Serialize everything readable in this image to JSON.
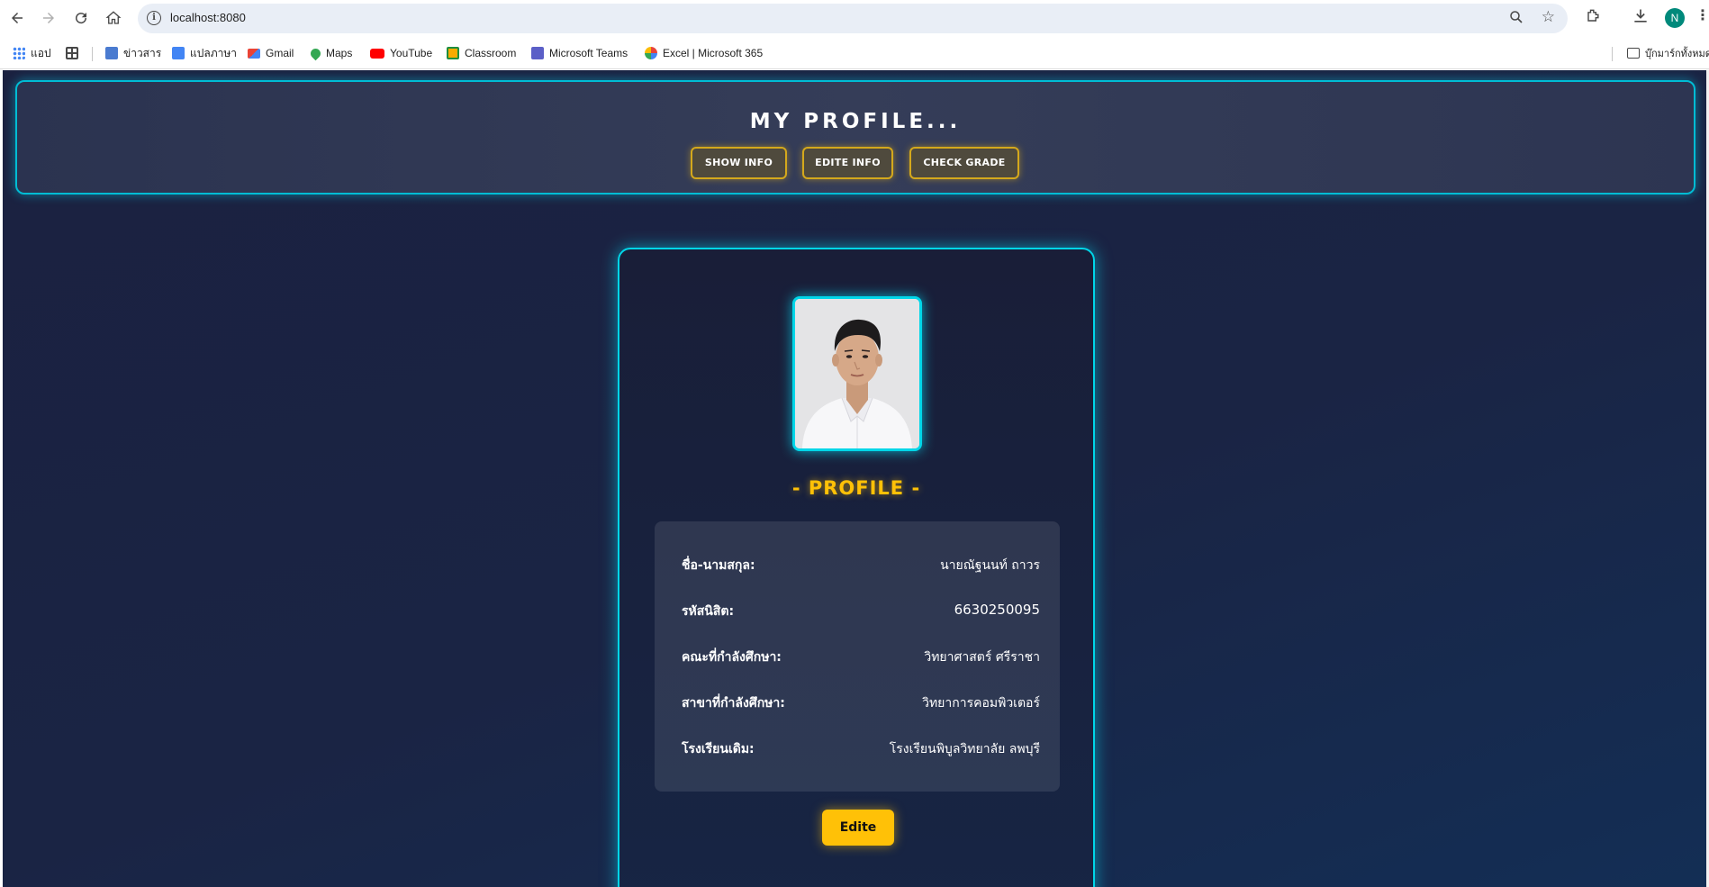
{
  "browser": {
    "url": "localhost:8080",
    "profile_initial": "N",
    "bookmarks": [
      {
        "label": "แอป",
        "icon": "apps-grid-icon"
      },
      {
        "label": "",
        "icon": "tab-groups-icon"
      },
      {
        "label": "ข่าวสาร",
        "icon": "news-icon"
      },
      {
        "label": "แปลภาษา",
        "icon": "translate-icon"
      },
      {
        "label": "Gmail",
        "icon": "gmail-icon"
      },
      {
        "label": "Maps",
        "icon": "maps-icon"
      },
      {
        "label": "YouTube",
        "icon": "youtube-icon"
      },
      {
        "label": "Classroom",
        "icon": "classroom-icon"
      },
      {
        "label": "Microsoft Teams",
        "icon": "teams-icon"
      },
      {
        "label": "Excel | Microsoft 365",
        "icon": "excel-icon"
      }
    ],
    "all_bookmarks_label": "บุ๊กมาร์กทั้งหมด"
  },
  "header": {
    "title": "MY PROFILE...",
    "buttons": {
      "show_info": "SHOW INFO",
      "edit_info": "EDITE INFO",
      "check_grade": "CHECK GRADE"
    }
  },
  "card": {
    "photo_alt": "Student photo",
    "section_title": "- PROFILE -",
    "fields": [
      {
        "label": "ชื่อ-นามสกุล:",
        "value": "นายณัฐนนท์ ถาวร"
      },
      {
        "label": "รหัสนิสิต:",
        "value": "6630250095"
      },
      {
        "label": "คณะที่กำลังศึกษา:",
        "value": "วิทยาศาสตร์ ศรีราชา"
      },
      {
        "label": "สาขาที่กำลังศึกษา:",
        "value": "วิทยาการคอมพิวเตอร์"
      },
      {
        "label": "โรงเรียนเดิม:",
        "value": "โรงเรียนพิบูลวิทยาลัย ลพบุรี"
      }
    ],
    "edit_button": "Edite"
  },
  "colors": {
    "accent_cyan": "#00d6e8",
    "accent_gold": "#ffc107",
    "background": "#1a2444"
  }
}
